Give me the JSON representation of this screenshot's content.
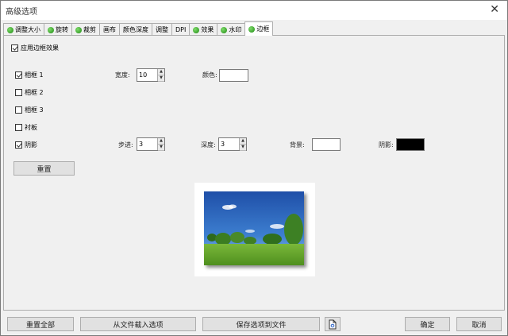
{
  "window": {
    "title": "高级选项"
  },
  "tabs": [
    {
      "label": "调整大小",
      "dot": true
    },
    {
      "label": "旋转",
      "dot": true
    },
    {
      "label": "裁剪",
      "dot": true
    },
    {
      "label": "画布",
      "dot": false
    },
    {
      "label": "颜色深度",
      "dot": false
    },
    {
      "label": "调整",
      "dot": false
    },
    {
      "label": "DPI",
      "dot": false
    },
    {
      "label": "效果",
      "dot": true
    },
    {
      "label": "水印",
      "dot": true
    },
    {
      "label": "边框",
      "dot": true,
      "active": true
    }
  ],
  "options": {
    "apply_label": "应用边框效果",
    "frame1": {
      "label": "相框 1",
      "checked": true,
      "width_label": "宽度:",
      "width_value": "10",
      "color_label": "颜色:",
      "color": "#ffffff"
    },
    "frame2": {
      "label": "相框 2",
      "checked": false
    },
    "frame3": {
      "label": "相框 3",
      "checked": false
    },
    "board": {
      "label": "衬板",
      "checked": false
    },
    "shadow": {
      "label": "阴影",
      "checked": true,
      "step_label": "步进:",
      "step_value": "3",
      "depth_label": "深度:",
      "depth_value": "3",
      "bg_label": "背景:",
      "bg_color": "#ffffff",
      "shadow_color_label": "阴影:",
      "shadow_color": "#000000"
    },
    "reset_label": "重置"
  },
  "footer": {
    "reset_all": "重置全部",
    "load_from_file": "从文件载入选项",
    "save_to_file": "保存选项到文件",
    "ok": "确定",
    "cancel": "取消"
  },
  "icons": {
    "close": "close-icon",
    "save-options": "document-icon"
  }
}
